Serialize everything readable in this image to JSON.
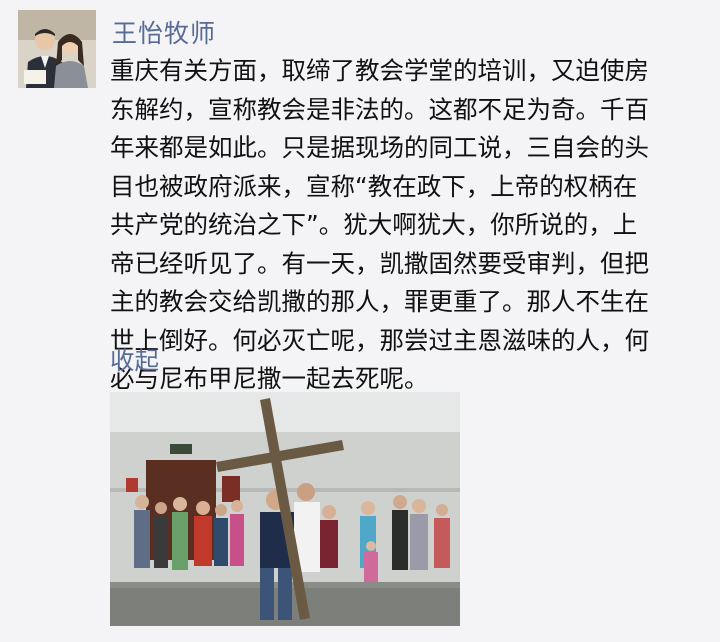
{
  "post": {
    "author": "王怡牧师",
    "text_lines": [
      "重庆有关方面，取缔了教会学堂的培训，又迫使房",
      "东解约，宣称教会是非法的。这都不足为奇。千百",
      "年来都是如此。只是据现场的同工说，三自会的头",
      "目也被政府派来，宣称“教在政下，上帝的权柄在",
      "共产党的统治之下”。犹大啊犹大，你所说的，上",
      "帝已经听见了。有一天，凯撒固然要受审判，但把",
      "主的教会交给凯撒的那人，罪更重了。那人不生在",
      "世上倒好。何必灭亡呢，那尝过主恩滋味的人，何",
      "必与尼布甲尼撒一起去死呢。"
    ],
    "collapse_label": "收起"
  },
  "colors": {
    "background": "#f4f4f6",
    "link": "#576b95",
    "text": "#111111"
  }
}
